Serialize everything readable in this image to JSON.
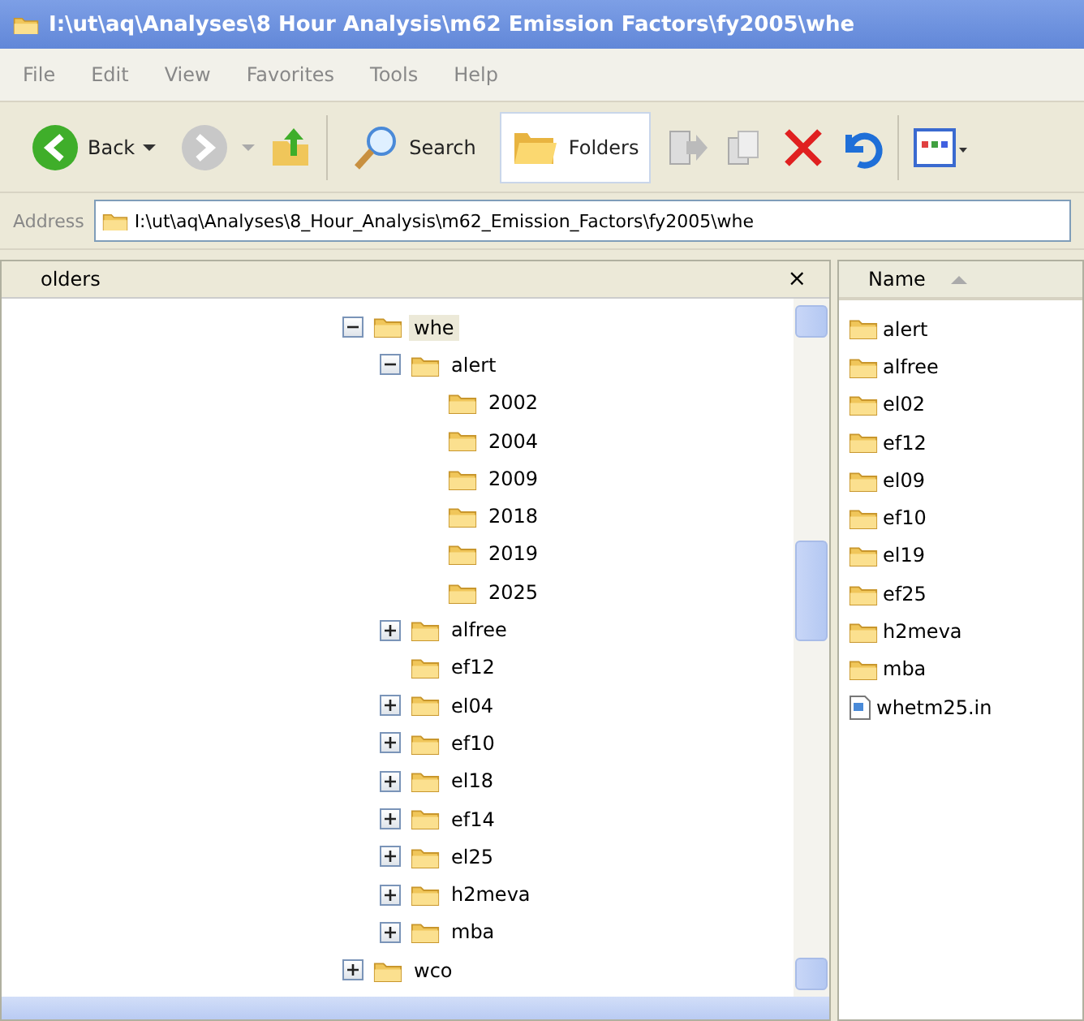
{
  "window": {
    "title": "I:\\ut\\aq\\Analyses\\8 Hour Analysis\\m62 Emission Factors\\fy2005\\whe"
  },
  "menu": [
    "File",
    "Edit",
    "View",
    "Favorites",
    "Tools",
    "Help"
  ],
  "toolbar": {
    "back": "Back",
    "search": "Search",
    "folders": "Folders",
    "folders_selected": true
  },
  "address": {
    "label": "Address",
    "value": "I:\\ut\\aq\\Analyses\\8_Hour_Analysis\\m62_Emission_Factors\\fy2005\\whe"
  },
  "folders_pane": {
    "title": "olders",
    "close": "×",
    "tree": [
      {
        "label": "whe",
        "selected": true,
        "expanded": true,
        "children": [
          {
            "label": "alert",
            "selected": false,
            "expanded": true,
            "children": [
              {
                "label": "2002",
                "selected": false
              },
              {
                "label": "2004",
                "selected": false
              },
              {
                "label": "2009",
                "selected": false
              },
              {
                "label": "2018",
                "selected": false
              },
              {
                "label": "2019",
                "selected": false
              },
              {
                "label": "2025",
                "selected": false
              }
            ]
          },
          {
            "label": "alfree",
            "selected": false,
            "expanded": false
          },
          {
            "label": "ef12",
            "selected": false
          },
          {
            "label": "el04",
            "selected": false,
            "expanded": false
          },
          {
            "label": "ef10",
            "selected": false,
            "expanded": false
          },
          {
            "label": "el18",
            "selected": false,
            "expanded": false
          },
          {
            "label": "ef14",
            "selected": false,
            "expanded": false
          },
          {
            "label": "el25",
            "selected": false,
            "expanded": false
          },
          {
            "label": "h2meva",
            "selected": false,
            "expanded": false
          },
          {
            "label": "mba",
            "selected": false,
            "expanded": false
          }
        ]
      },
      {
        "label": "wco",
        "selected": false,
        "expanded": false
      }
    ]
  },
  "file_list": {
    "column": "Name",
    "items": [
      {
        "name": "alert",
        "kind": "folder"
      },
      {
        "name": "alfree",
        "kind": "folder"
      },
      {
        "name": "el02",
        "kind": "folder"
      },
      {
        "name": "ef12",
        "kind": "folder"
      },
      {
        "name": "el09",
        "kind": "folder"
      },
      {
        "name": "ef10",
        "kind": "folder"
      },
      {
        "name": "el19",
        "kind": "folder"
      },
      {
        "name": "ef25",
        "kind": "folder"
      },
      {
        "name": "h2meva",
        "kind": "folder"
      },
      {
        "name": "mba",
        "kind": "folder"
      },
      {
        "name": "whetm25.in",
        "kind": "file"
      }
    ]
  }
}
